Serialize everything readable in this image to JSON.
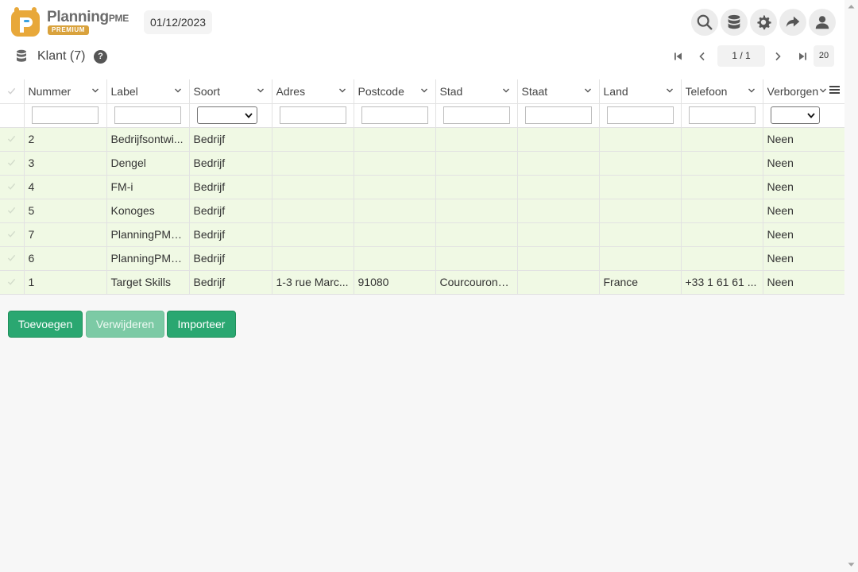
{
  "brand": {
    "name": "Planning",
    "suffix": "PME",
    "badge": "PREMIUM"
  },
  "header": {
    "date": "01/12/2023"
  },
  "page": {
    "title": "Klant (7)",
    "help": "?"
  },
  "pager": {
    "page_display": "1 / 1",
    "page_size": "20"
  },
  "columns": [
    "Nummer",
    "Label",
    "Soort",
    "Adres",
    "Postcode",
    "Stad",
    "Staat",
    "Land",
    "Telefoon",
    "Verborgen"
  ],
  "rows": [
    {
      "nummer": "2",
      "label": "Bedrijfsontwi...",
      "soort": "Bedrijf",
      "adres": "",
      "postcode": "",
      "stad": "",
      "staat": "",
      "land": "",
      "telefoon": "",
      "verborgen": "Neen"
    },
    {
      "nummer": "3",
      "label": "Dengel",
      "soort": "Bedrijf",
      "adres": "",
      "postcode": "",
      "stad": "",
      "staat": "",
      "land": "",
      "telefoon": "",
      "verborgen": "Neen"
    },
    {
      "nummer": "4",
      "label": "FM-i",
      "soort": "Bedrijf",
      "adres": "",
      "postcode": "",
      "stad": "",
      "staat": "",
      "land": "",
      "telefoon": "",
      "verborgen": "Neen"
    },
    {
      "nummer": "5",
      "label": "Konoges",
      "soort": "Bedrijf",
      "adres": "",
      "postcode": "",
      "stad": "",
      "staat": "",
      "land": "",
      "telefoon": "",
      "verborgen": "Neen"
    },
    {
      "nummer": "7",
      "label": "PlanningPME...",
      "soort": "Bedrijf",
      "adres": "",
      "postcode": "",
      "stad": "",
      "staat": "",
      "land": "",
      "telefoon": "",
      "verborgen": "Neen"
    },
    {
      "nummer": "6",
      "label": "PlanningPME...",
      "soort": "Bedrijf",
      "adres": "",
      "postcode": "",
      "stad": "",
      "staat": "",
      "land": "",
      "telefoon": "",
      "verborgen": "Neen"
    },
    {
      "nummer": "1",
      "label": "Target Skills",
      "soort": "Bedrijf",
      "adres": "1-3 rue Marc...",
      "postcode": "91080",
      "stad": "Courcouronn...",
      "staat": "",
      "land": "France",
      "telefoon": "+33 1 61 61 ...",
      "verborgen": "Neen"
    }
  ],
  "buttons": {
    "add": "Toevoegen",
    "delete": "Verwijderen",
    "import": "Importeer"
  },
  "colors": {
    "accent_green": "#2aa771",
    "row_bg": "#f0f9e4",
    "brand_gold": "#d9a23c"
  }
}
